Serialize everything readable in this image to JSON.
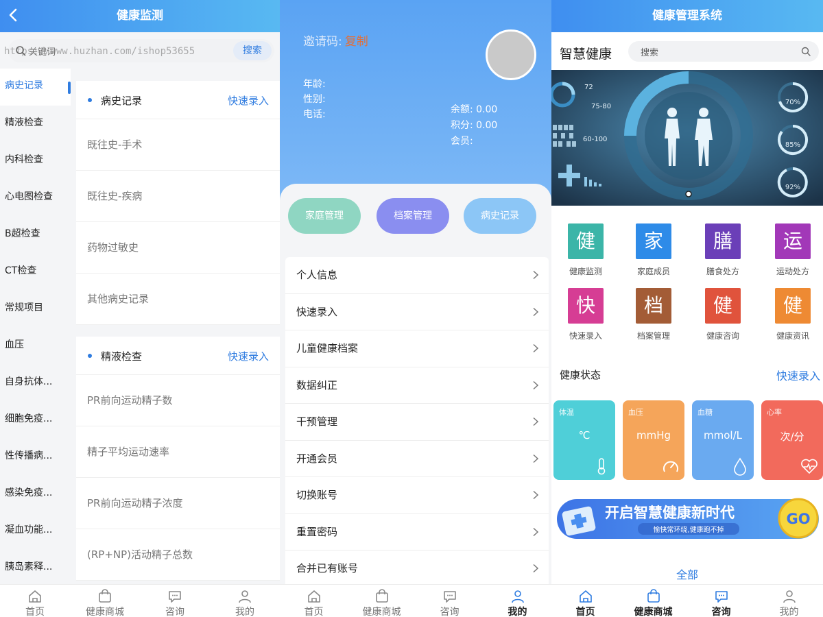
{
  "panel1": {
    "title": "健康监测",
    "search_placeholder": "关键词",
    "search_button": "搜索",
    "watermark": "https://www.huzhan.com/ishop53655",
    "categories": [
      "病史记录",
      "精液检查",
      "内科检查",
      "心电图检查",
      "B超检查",
      "CT检查",
      "常规项目",
      "血压",
      "自身抗体...",
      "细胞免疫...",
      "性传播病...",
      "感染免疫...",
      "凝血功能...",
      "胰岛素释..."
    ],
    "cards": [
      {
        "title": "病史记录",
        "quick": "快速录入",
        "rows": [
          "既往史-手术",
          "既往史-疾病",
          "药物过敏史",
          "其他病史记录"
        ]
      },
      {
        "title": "精液检查",
        "quick": "快速录入",
        "rows": [
          "PR前向运动精子数",
          "精子平均运动速率",
          "PR前向运动精子浓度",
          "(RP+NP)活动精子总数"
        ]
      }
    ],
    "tabs": [
      "首页",
      "健康商城",
      "咨询",
      "我的"
    ]
  },
  "panel2": {
    "invite_label": "邀请码:",
    "copy": "复制",
    "age": "年龄:",
    "gender": "性别:",
    "phone": "电话:",
    "balance": "余额:  0.00",
    "points": "积分:  0.00",
    "member": "会员:",
    "pills": [
      {
        "label": "家庭管理",
        "color": "#8fd6c2"
      },
      {
        "label": "档案管理",
        "color": "#8a8ef0"
      },
      {
        "label": "病史记录",
        "color": "#8cc6f6"
      }
    ],
    "menu": [
      "个人信息",
      "快速录入",
      "儿童健康档案",
      "数据纠正",
      "干预管理",
      "开通会员",
      "切换账号",
      "重置密码",
      "合并已有账号"
    ],
    "tabs": [
      "首页",
      "健康商城",
      "咨询",
      "我的"
    ]
  },
  "panel3": {
    "title": "健康管理系统",
    "brand": "智慧健康",
    "search_placeholder": "搜索",
    "banner": {
      "hr1": "72",
      "hr2": "75-80",
      "bp": "60-100",
      "g1": "70%",
      "g2": "85%",
      "g3": "92%"
    },
    "grid": [
      {
        "char": "健",
        "label": "健康监测",
        "color": "#3bb5a8"
      },
      {
        "char": "家",
        "label": "家庭成员",
        "color": "#2e8be8"
      },
      {
        "char": "膳",
        "label": "膳食处方",
        "color": "#6b3fb8"
      },
      {
        "char": "运",
        "label": "运动处方",
        "color": "#a238b8"
      },
      {
        "char": "快",
        "label": "快速录入",
        "color": "#d63d94"
      },
      {
        "char": "档",
        "label": "档案管理",
        "color": "#a35c36"
      },
      {
        "char": "健",
        "label": "健康咨询",
        "color": "#e0533c"
      },
      {
        "char": "健",
        "label": "健康资讯",
        "color": "#ee8a33"
      }
    ],
    "health_status": "健康状态",
    "quick": "快速录入",
    "cards": [
      {
        "name": "体温",
        "unit": "℃",
        "color": "#4fcfd8"
      },
      {
        "name": "血压",
        "unit": "mmHg",
        "color": "#f5a55a"
      },
      {
        "name": "血糖",
        "unit": "mmol/L",
        "color": "#6aaaf0"
      },
      {
        "name": "心率",
        "unit": "次/分",
        "color": "#f26a5c"
      }
    ],
    "cta_title": "开启智慧健康新时代",
    "cta_sub": "愉快常环绕,健康跑不掉",
    "cta_go": "GO",
    "all": "全部",
    "tabs": [
      "首页",
      "健康商城",
      "咨询",
      "我的"
    ]
  },
  "colors": {
    "accent": "#2f7ce0"
  },
  "icons": [
    "back-icon",
    "search-icon",
    "chevron-right-icon",
    "home-icon",
    "bag-icon",
    "chat-icon",
    "user-icon"
  ]
}
